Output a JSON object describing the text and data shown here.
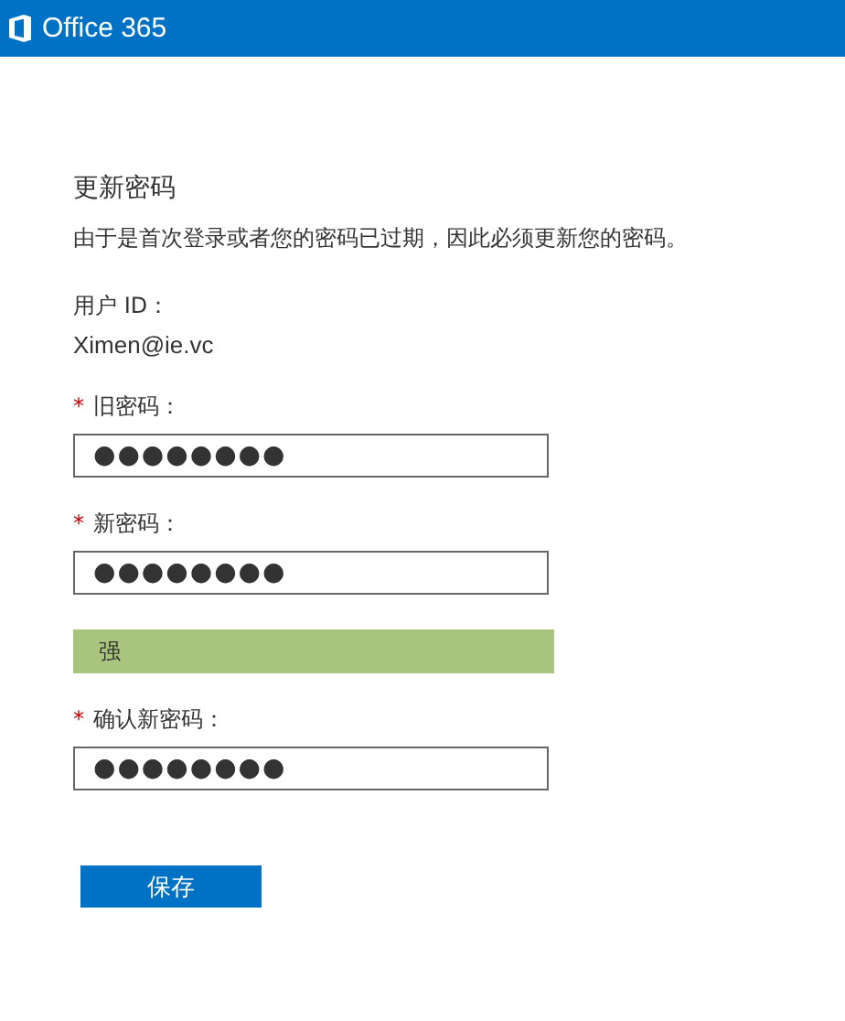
{
  "header": {
    "title": "Office 365"
  },
  "form": {
    "title": "更新密码",
    "message": "由于是首次登录或者您的密码已过期，因此必须更新您的密码。",
    "user_id_label": "用户 ID：",
    "user_id": "Ximen@ie.vc",
    "items": [
      {
        "kind": "field",
        "required_mark": "*",
        "label": "旧密码：",
        "value": "●●●●●●●●"
      },
      {
        "kind": "field",
        "required_mark": "*",
        "label": "新密码：",
        "value": "●●●●●●●●"
      },
      {
        "kind": "strength",
        "label": "强",
        "level": 1
      },
      {
        "kind": "field",
        "required_mark": "*",
        "label": "确认新密码：",
        "value": "●●●●●●●●"
      }
    ],
    "save_button": "保存"
  }
}
